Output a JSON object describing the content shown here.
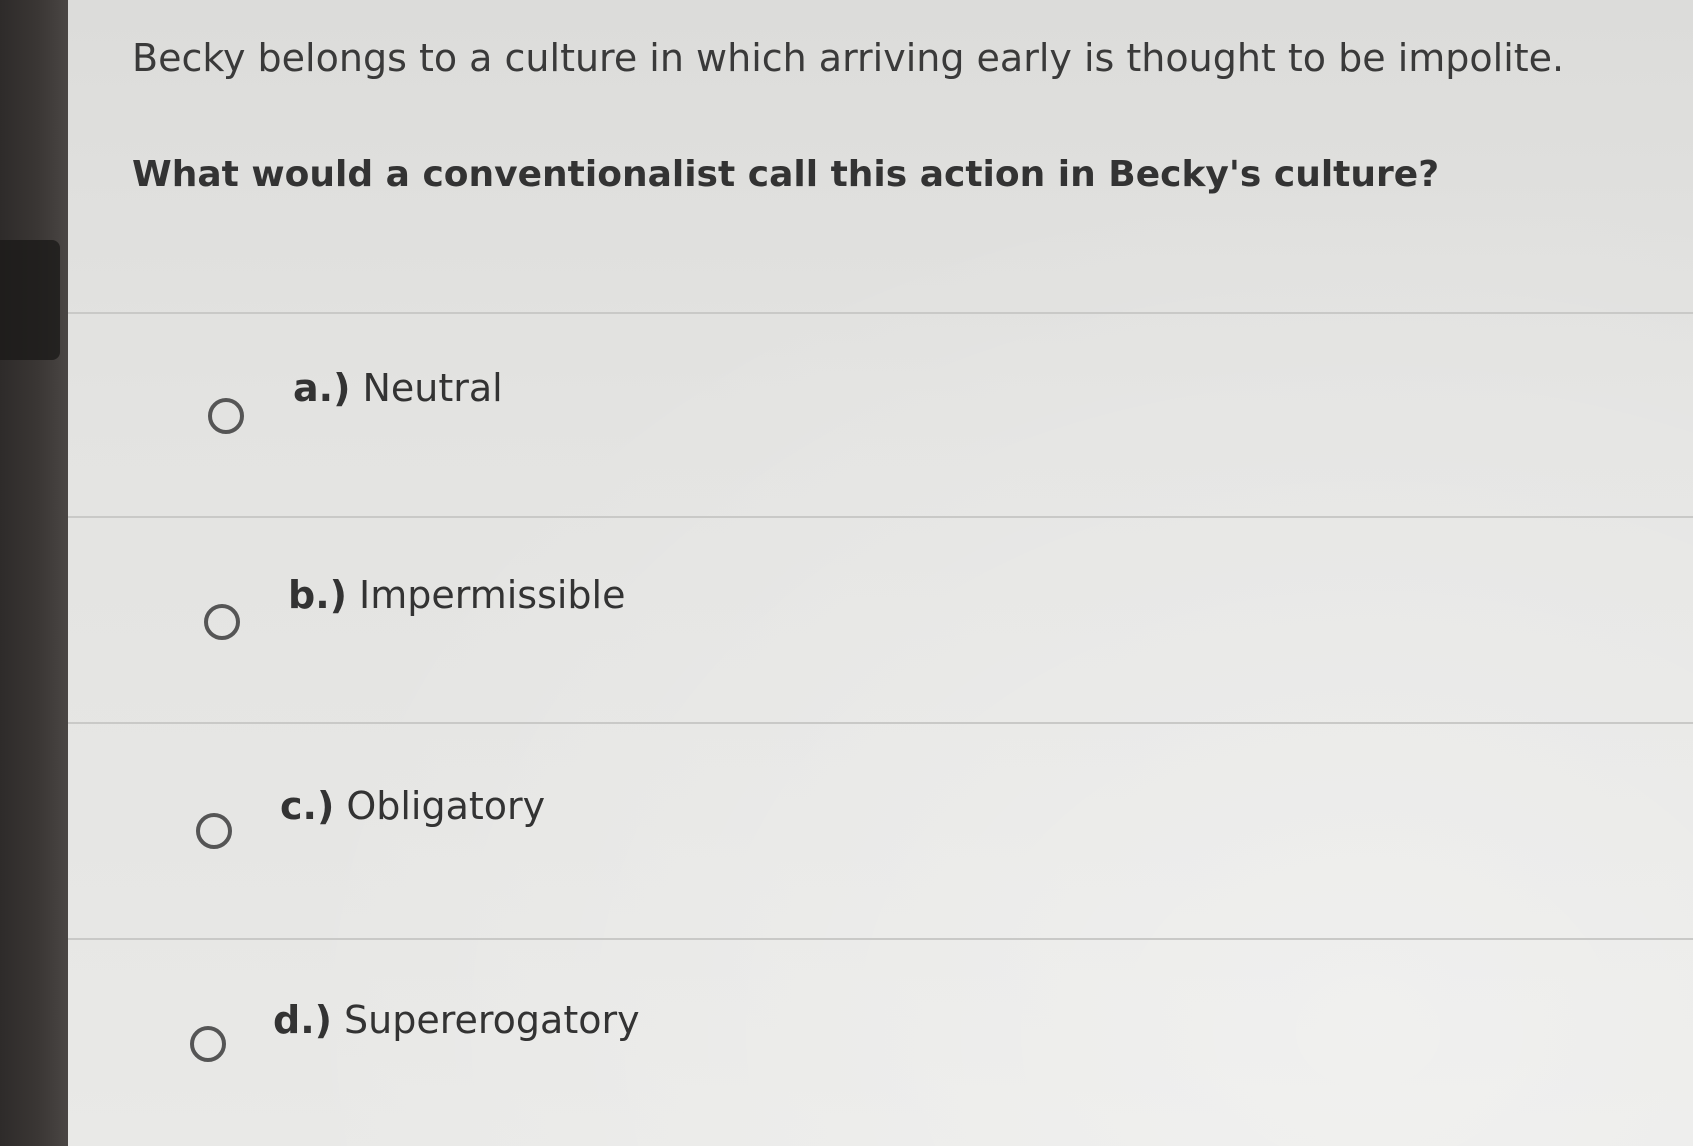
{
  "question": {
    "statement": "Becky belongs to a culture in which arriving early is thought to be impolite.",
    "prompt": "What would a conventionalist call this action in Becky's culture?"
  },
  "options": [
    {
      "letter": "a.)",
      "label": "Neutral"
    },
    {
      "letter": "b.)",
      "label": "Impermissible"
    },
    {
      "letter": "c.)",
      "label": "Obligatory"
    },
    {
      "letter": "d.)",
      "label": "Supererogatory"
    }
  ]
}
